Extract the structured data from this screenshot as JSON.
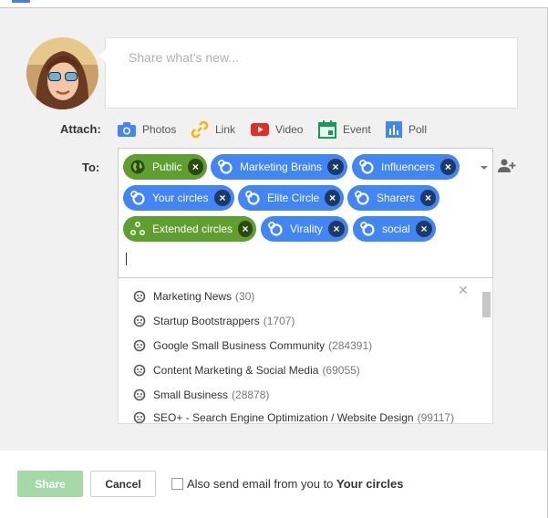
{
  "share": {
    "placeholder": "Share what's new...",
    "attach_label": "Attach:",
    "to_label": "To:"
  },
  "attach": [
    {
      "label": "Photos",
      "icon": "camera-icon",
      "color": "#4285f4"
    },
    {
      "label": "Link",
      "icon": "link-icon",
      "color": "#f4b400"
    },
    {
      "label": "Video",
      "icon": "video-icon",
      "color": "#e52d27"
    },
    {
      "label": "Event",
      "icon": "calendar-icon",
      "color": "#0f9d58"
    },
    {
      "label": "Poll",
      "icon": "poll-icon",
      "color": "#4285f4"
    }
  ],
  "recipients": [
    {
      "label": "Public",
      "type": "public",
      "color": "#5e9f2f"
    },
    {
      "label": "Marketing Brains",
      "type": "circle",
      "color": "#4285f4"
    },
    {
      "label": "Influencers",
      "type": "circle",
      "color": "#4285f4"
    },
    {
      "label": "Your circles",
      "type": "circle",
      "color": "#4285f4"
    },
    {
      "label": "Elite Circle",
      "type": "circle",
      "color": "#4285f4"
    },
    {
      "label": "Sharers",
      "type": "circle",
      "color": "#4285f4"
    },
    {
      "label": "Extended circles",
      "type": "extended",
      "color": "#5e9f2f"
    },
    {
      "label": "Virality",
      "type": "circle",
      "color": "#4285f4"
    },
    {
      "label": "social",
      "type": "circle",
      "color": "#4285f4"
    }
  ],
  "suggestions": [
    {
      "name": "Marketing News",
      "count": "(30)"
    },
    {
      "name": "Startup Bootstrappers",
      "count": "(1707)"
    },
    {
      "name": "Google Small Business Community",
      "count": "(284391)"
    },
    {
      "name": "Content Marketing & Social Media",
      "count": "(69055)"
    },
    {
      "name": "Small Business",
      "count": "(28878)"
    },
    {
      "name": "SEO+ - Search Engine Optimization / Website Design",
      "count": "(99117)"
    }
  ],
  "footer": {
    "share_label": "Share",
    "cancel_label": "Cancel",
    "email_prefix": "Also send email from you to ",
    "email_target": "Your circles"
  }
}
